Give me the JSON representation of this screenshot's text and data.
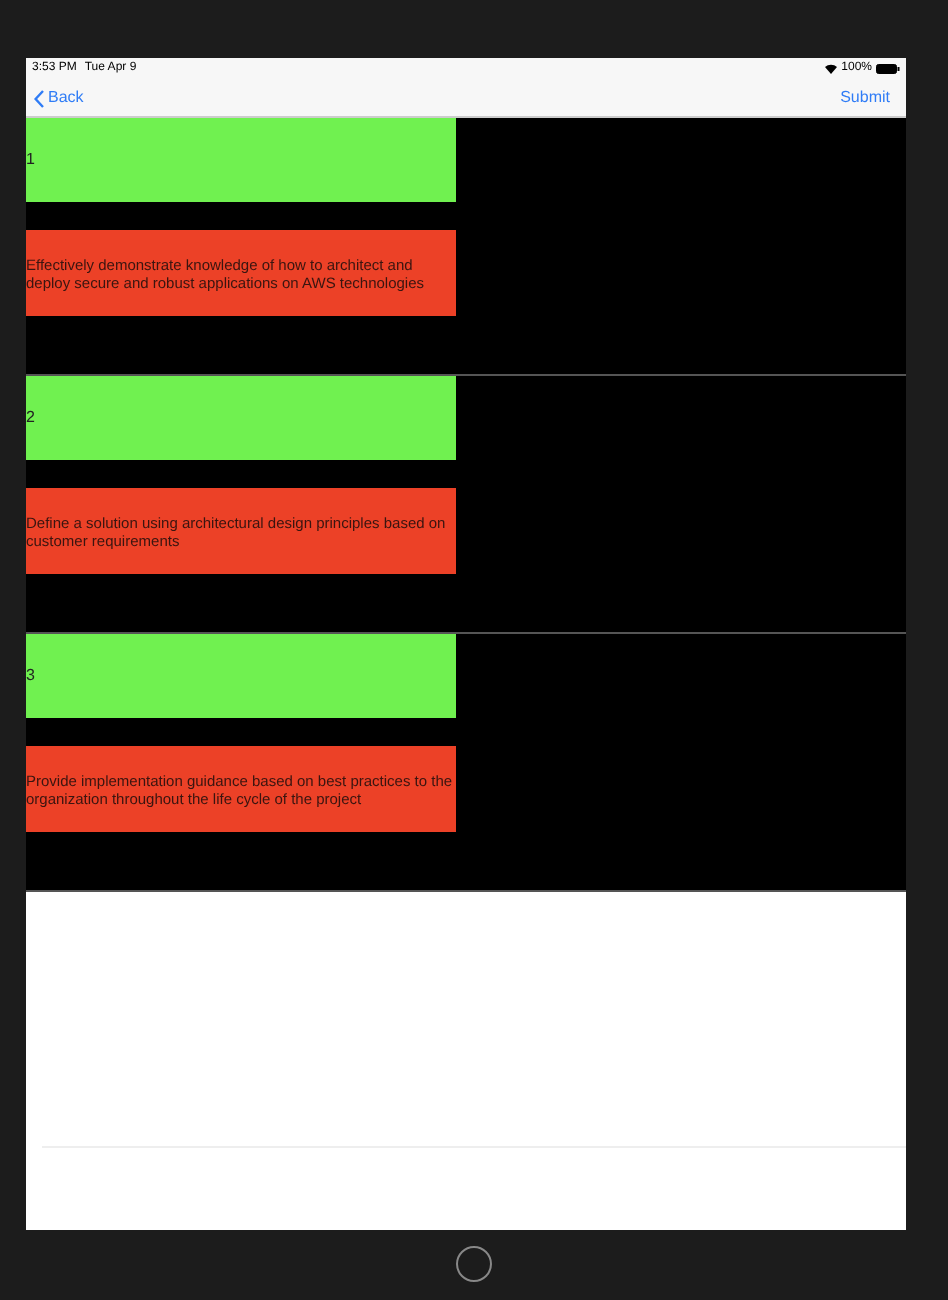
{
  "status_bar": {
    "time": "3:53 PM",
    "date": "Tue Apr 9",
    "battery": "100%"
  },
  "nav_bar": {
    "back": "Back",
    "action": "Submit"
  },
  "objectives": [
    {
      "number": "1",
      "text": "Effectively demonstrate knowledge of how to architect and deploy secure and robust applications on AWS technologies"
    },
    {
      "number": "2",
      "text": "Define a solution using architectural design principles based on customer requirements"
    },
    {
      "number": "3",
      "text": "Provide implementation guidance based on best practices to the organization throughout the life cycle of the project"
    }
  ]
}
